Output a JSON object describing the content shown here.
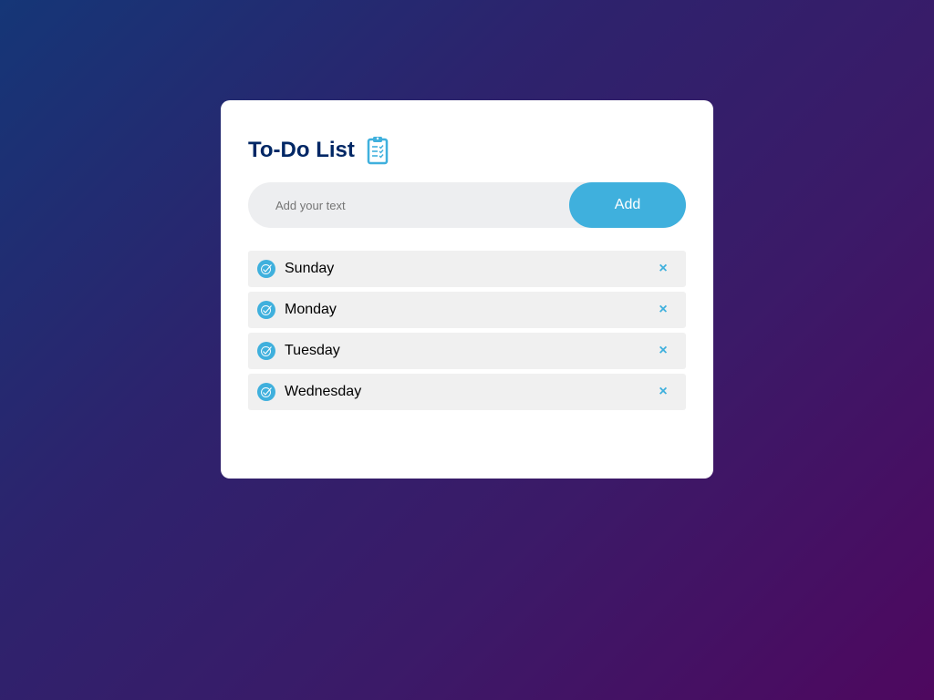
{
  "app": {
    "title": "To-Do List",
    "title_icon": "clipboard-checklist-icon"
  },
  "input": {
    "placeholder": "Add your text",
    "value": ""
  },
  "add_button": {
    "label": "Add"
  },
  "tasks": [
    {
      "text": "Sunday",
      "checked": true
    },
    {
      "text": "Monday",
      "checked": true
    },
    {
      "text": "Tuesday",
      "checked": true
    },
    {
      "text": "Wednesday",
      "checked": true
    }
  ],
  "remove_glyph": "×",
  "colors": {
    "accent": "#3fb0dd",
    "title": "#002765",
    "task_bg": "#f0f0f0",
    "input_bg": "#edeef0",
    "gradient_start": "#153677",
    "gradient_end": "#4e085f"
  }
}
